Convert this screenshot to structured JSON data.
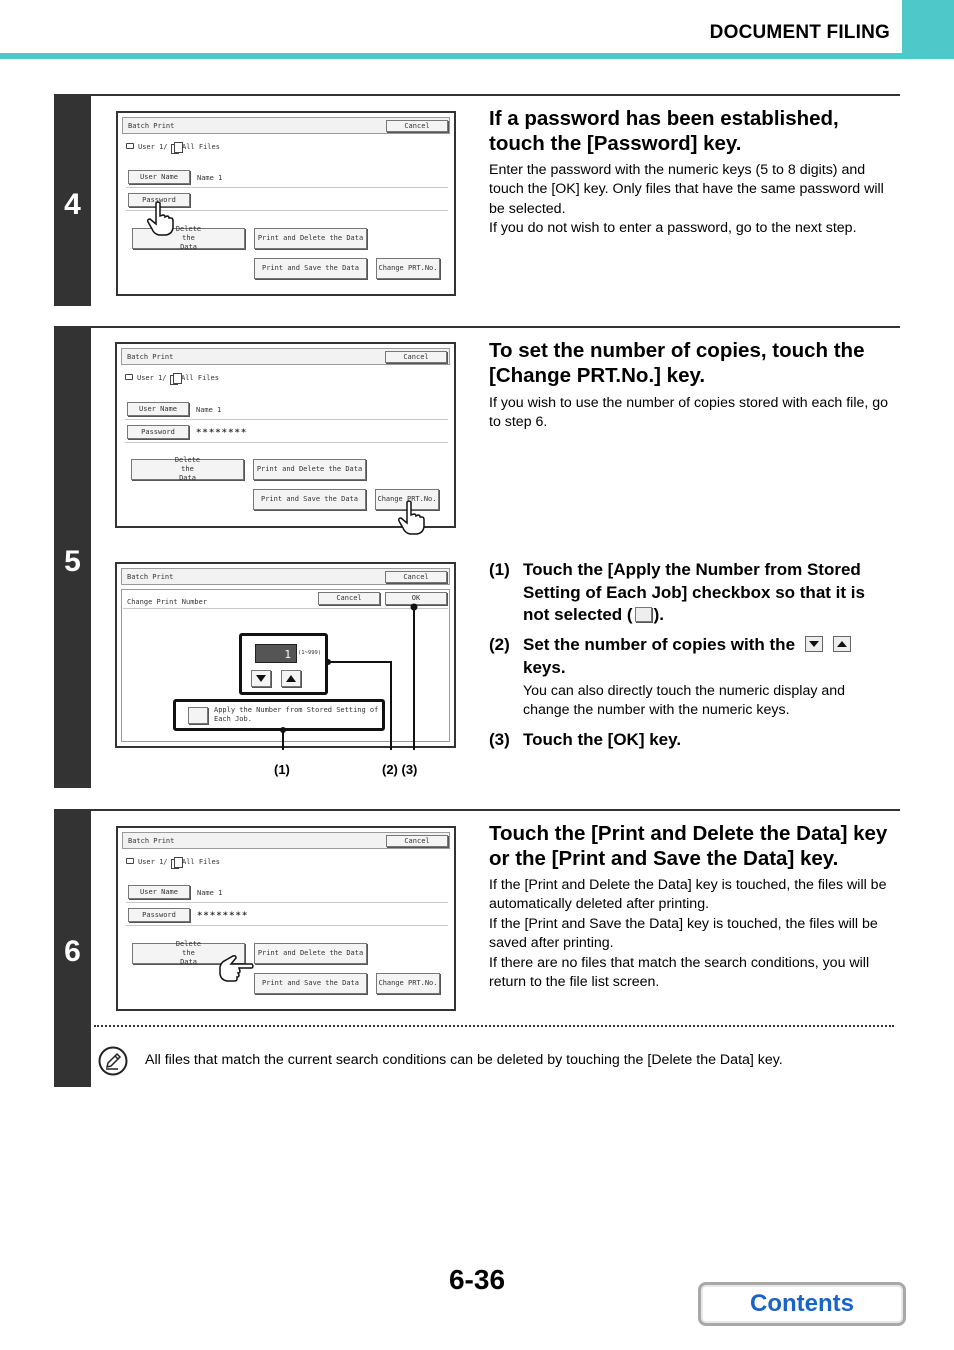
{
  "header": {
    "section_title": "DOCUMENT FILING"
  },
  "screen_common": {
    "batch_print": "Batch Print",
    "cancel": "Cancel",
    "user_path": "User 1/",
    "all_files": "All Files",
    "user_name_btn": "User Name",
    "user_name_value": "Name 1",
    "password_btn": "Password",
    "password_mask": "********",
    "delete_data": "Delete the Data",
    "print_delete": "Print and Delete the Data",
    "print_save": "Print and Save the Data",
    "change_prt": "Change PRT.No.",
    "change_print_number": "Change Print Number",
    "ok": "OK",
    "count_value": "1",
    "count_range": "(1~999)",
    "apply_stored": "Apply the Number from Stored Setting of Each Job."
  },
  "steps": [
    {
      "number": "4",
      "heading": "If a password has been established, touch the [Password] key.",
      "body": [
        "Enter the password with the numeric keys (5 to 8 digits) and touch the [OK] key. Only files that have the same password will be selected.",
        "If you do not wish to enter a password, go to the next step."
      ]
    },
    {
      "number": "5",
      "heading": "To set the number of copies, touch the [Change PRT.No.] key.",
      "body": [
        "If you wish to use the number of copies stored with each file, go to step 6."
      ],
      "substeps": [
        {
          "num": "(1)",
          "text_a": "Touch the [Apply the Number from Stored Setting of Each Job] checkbox so that it is not selected (",
          "text_b": ")."
        },
        {
          "num": "(2)",
          "text": "Set the number of copies with the",
          "text_b": "keys.",
          "note": "You can also directly touch the numeric display and change the number with the numeric keys."
        },
        {
          "num": "(3)",
          "text": "Touch the [OK] key."
        }
      ],
      "callouts": {
        "c1": "(1)",
        "c23": "(2) (3)"
      }
    },
    {
      "number": "6",
      "heading": "Touch the [Print and Delete the Data] key or the [Print and Save the Data] key.",
      "body": [
        "If the [Print and Delete the Data] key is touched, the files will be automatically deleted after printing.",
        "If the [Print and Save the Data] key is touched, the files will be saved after printing.",
        "If there are no files that match the search conditions, you will return to the file list screen."
      ]
    }
  ],
  "note": {
    "text": "All files that match the current search conditions can be deleted by touching the [Delete the Data] key."
  },
  "footer": {
    "page_number": "6-36",
    "contents_label": "Contents"
  }
}
